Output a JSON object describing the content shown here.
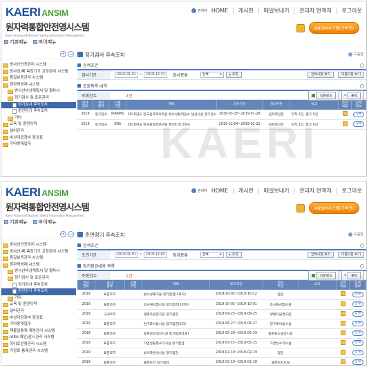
{
  "brand": {
    "logo_main": "KAERI",
    "logo_sub": "ANSIM",
    "system_name": "원자력통합안전영시스템",
    "tagline": "Kaeri Advanced Nuclear Safety Information Management"
  },
  "nav": {
    "user": "관리자",
    "items": [
      "HOME",
      "게시판",
      "메일보내기",
      "관리자 면책저",
      "로그아웃"
    ]
  },
  "syslink": {
    "label": "ANSIM시스템(구버전)"
  },
  "tabs": {
    "left": "기본메뉴",
    "right": "마이메뉴"
  },
  "watermark": "KAERI",
  "screen1": {
    "title": "정기검사 후속조치",
    "help": "도움말",
    "cond_title": "검색조건",
    "period_label": "검사기간",
    "date_from": "2016-01-01",
    "date_to": "2019-12-31",
    "type_label": "검사종류",
    "type_value": "전체",
    "search_btn": "조회",
    "btn_all": "전체사항 보기",
    "btn_done": "미결사항 보기",
    "list_title": "조회목록 내역",
    "count_label": "조회건수",
    "count": "2건",
    "download": "다운로드",
    "print": "출력",
    "table": {
      "headers": [
        "검사\n연도",
        "검사\n종류",
        "시설\n구분",
        "제목",
        "검사기간",
        "검사주관",
        "비고",
        "조치\n내용",
        "상세\n정보"
      ],
      "rows": [
        [
          "2019",
          "정기검사",
          "KIRAMS",
          "2019년도 한국원자력의학원 방사성동위원소 생산시설 정기검사(2019년)...",
          "2019-03-25~2019-01-28",
          "원자력안전",
          "지적 2건, 권고 0건",
          "",
          "상세"
        ],
        [
          "2019",
          "정기검사",
          "KNS",
          "2019년도 한국원자력연구원 제3차 정기검사",
          "2019-12-04~2019-02-22",
          "원자력안전",
          "지적 1건, 권고 0건",
          "",
          "상세"
        ]
      ]
    }
  },
  "screen2": {
    "title": "준연정기 후속조치",
    "help": "도움말",
    "cond_title": "검색조건",
    "period_label": "조연기간",
    "date_from": "2019-01-01",
    "date_to": "2019-12-03",
    "type_label": "점검종류",
    "type_value": "전체",
    "search_btn": "조회",
    "btn_all": "전체사항 보기",
    "btn_done": "미결사항 보기",
    "list_title": "정기점검내용 목록",
    "count_label": "조회건수",
    "count": "1건",
    "download": "다운로드",
    "print": "출력",
    "table": {
      "headers": [
        "검사\n연도",
        "검사\n종류",
        "시설\n구분",
        "제목",
        "조치기간",
        "검사\n주관",
        "비고",
        "조치\n내용",
        "상세\n정보"
      ],
      "rows": [
        [
          "2019",
          "표준조치",
          "",
          "방사성폐기물 정기점검(1회차)",
          "2019-10-02~2019-10-12",
          "점검",
          "",
          "",
          "상세"
        ],
        [
          "2019",
          "표준조치",
          "",
          "조사재시험시설 정기점검(1회차)",
          "2019-10-01~2019-10-01",
          "조사재시험시설",
          "",
          "",
          "상세"
        ],
        [
          "2019",
          "구내조치",
          "",
          "생명자원연구원 정기점검",
          "2019-09-25~2019-09-25",
          "생명자원연구원",
          "",
          "",
          "상세"
        ],
        [
          "2019",
          "표준조치",
          "",
          "연구로이용시설 정기점검(1회)",
          "2019-06-27~2019-06-27",
          "연구로이용시설",
          "",
          "",
          "상세"
        ],
        [
          "2019",
          "표준조치",
          "",
          "동위원소생산시설 정기점검(1회)",
          "2019-05-29~2019-05-29",
          "동위원소생산시설",
          "",
          "",
          "상세"
        ],
        [
          "2019",
          "표준조치",
          "",
          "가연성물질소각시설 정기점검",
          "2019-05-15~2019-05-15",
          "가연성소각시설",
          "",
          "",
          "상세"
        ],
        [
          "2019",
          "표준조치",
          "",
          "방사화분석시설 정기점검",
          "2019-02-19~2019-02-19",
          "점검",
          "",
          "",
          "상세"
        ],
        [
          "2019",
          "표준조치",
          "",
          "표준조치 정기점검",
          "2019-02-19~2019-02-18",
          "표준조치시설",
          "",
          "",
          "상세"
        ]
      ]
    }
  },
  "tree1": [
    {
      "t": "방사선안전관리 시스템",
      "lv": 0,
      "k": "f"
    },
    {
      "t": "방사선/폐 측정기기 교정관리 시스템",
      "lv": 0,
      "k": "f"
    },
    {
      "t": "품질보증관리 시스템",
      "lv": 0,
      "k": "f"
    },
    {
      "t": "원자력방재 시스템",
      "lv": 0,
      "k": "f"
    },
    {
      "t": "방사선비상계획서 및 절차서",
      "lv": 1,
      "k": "f"
    },
    {
      "t": "정기검사 및 표준관리",
      "lv": 1,
      "k": "f"
    },
    {
      "t": "정기검사 후속조치",
      "lv": 2,
      "k": "d",
      "sel": true
    },
    {
      "t": "준연정기 후속조치",
      "lv": 2,
      "k": "d"
    },
    {
      "t": "기타",
      "lv": 1,
      "k": "f"
    },
    {
      "t": "교육 및 훈련이력",
      "lv": 0,
      "k": "f"
    },
    {
      "t": "설비관리",
      "lv": 0,
      "k": "f"
    },
    {
      "t": "비상대응장비 점검표",
      "lv": 0,
      "k": "f"
    },
    {
      "t": "기타방재업무",
      "lv": 0,
      "k": "f"
    }
  ],
  "tree2": [
    {
      "t": "방사선안전관리 시스템",
      "lv": 0,
      "k": "f"
    },
    {
      "t": "방사선/폐 측정기기 교정관리 시스템",
      "lv": 0,
      "k": "f"
    },
    {
      "t": "품질보증관리 시스템",
      "lv": 0,
      "k": "f"
    },
    {
      "t": "원자력방재 시스템",
      "lv": 0,
      "k": "f"
    },
    {
      "t": "방사선비상계획서 및 절차서",
      "lv": 1,
      "k": "f"
    },
    {
      "t": "정기검사 및 표준관리",
      "lv": 1,
      "k": "f"
    },
    {
      "t": "정기검사 후속조치",
      "lv": 2,
      "k": "d"
    },
    {
      "t": "준연정기 후속조치",
      "lv": 2,
      "k": "d",
      "sel": true
    },
    {
      "t": "기타",
      "lv": 1,
      "k": "f"
    },
    {
      "t": "교육 및 훈련이력",
      "lv": 0,
      "k": "f"
    },
    {
      "t": "설비관리",
      "lv": 0,
      "k": "f"
    },
    {
      "t": "비상대응장비 점검표",
      "lv": 0,
      "k": "f"
    },
    {
      "t": "기타방재업무",
      "lv": 0,
      "k": "f"
    },
    {
      "t": "핵물질통제 계량관리 시스템",
      "lv": 0,
      "k": "f"
    },
    {
      "t": "IAEA 확인/감시관리 시스템",
      "lv": 0,
      "k": "f"
    },
    {
      "t": "하이로운영관리 시스템",
      "lv": 0,
      "k": "f"
    },
    {
      "t": "기장로 통제관리 시스템",
      "lv": 0,
      "k": "f"
    }
  ]
}
